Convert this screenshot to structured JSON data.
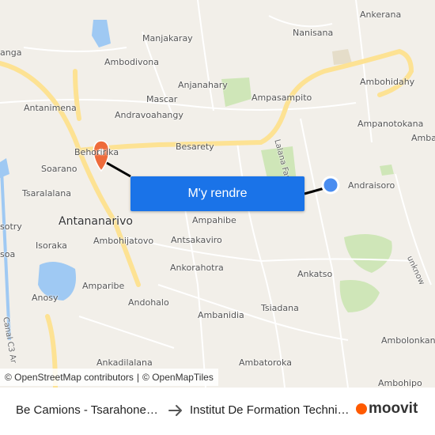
{
  "map": {
    "labels": {
      "manjakaray": "Manjakaray",
      "nanisana": "Nanisana",
      "ankerana": "Ankerana",
      "ambodivona": "Ambodivona",
      "anjanahary": "Anjanahary",
      "ambohidahy": "Ambohidahy",
      "mascar": "Mascar",
      "ampasampito": "Ampasampito",
      "antanimena": "Antanimena",
      "andravoahangy": "Andravoahangy",
      "ampanotokana": "Ampanotokana",
      "besarety": "Besarety",
      "behoririka": "Behoririka",
      "soarano": "Soarano",
      "tsaralalana": "Tsaralalana",
      "andraisoro": "Andraisoro",
      "antananarivo": "Antananarivo",
      "ampahibe": "Ampahibe",
      "isoraka": "Isoraka",
      "ambohijatovo": "Ambohijatovo",
      "antsakaviro": "Antsakaviro",
      "ankorahotra": "Ankorahotra",
      "ankatso": "Ankatso",
      "amparibe": "Amparibe",
      "anosy": "Anosy",
      "andohalo": "Andohalo",
      "ambanidia": "Ambanidia",
      "tsiadana": "Tsiadana",
      "ambolonkandrina": "Ambolonkandrina",
      "ankadilalana": "Ankadilalana",
      "ambatoroka": "Ambatoroka",
      "ambohipo": "Ambohipo",
      "labana_faratsiho": "Lalana Faratsiho",
      "unknown_road": "unknow",
      "canal": "Canal C3 Ar",
      "partial_left_1": "anga",
      "partial_left_2": "sotry",
      "partial_left_3": "soa",
      "partial_right_1": "Amba"
    },
    "route_button_label": "M'y rendre",
    "attribution": {
      "osm": "© OpenStreetMap contributors",
      "separator": "|",
      "omt": "© OpenMapTiles"
    },
    "colors": {
      "land": "#f2efe9",
      "major_road": "#fde293",
      "water": "#9fc9f3",
      "green": "#cfe6b8",
      "route_line": "#000000",
      "origin_pin": "#ee6b3b",
      "destination_dot": "#4a8df0"
    }
  },
  "footer": {
    "from": "Be Camions - Tsarahonenana",
    "to": "Institut De Formation Technique",
    "brand": "moovit"
  }
}
